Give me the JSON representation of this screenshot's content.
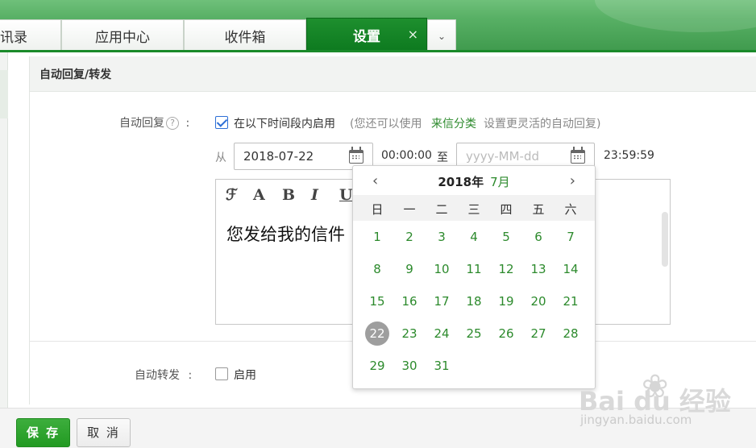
{
  "tabs": {
    "tab1": "讯录",
    "tab2": "应用中心",
    "tab3": "收件箱",
    "active": "设置",
    "close": "×",
    "more": "⌄"
  },
  "panel": {
    "title": "自动回复/转发"
  },
  "auto_reply": {
    "label": "自动回复",
    "help": "?",
    "colon": ":",
    "enable_label": "在以下时间段内启用",
    "hint_prefix": "(您还可以使用",
    "hint_link": "来信分类",
    "hint_suffix": "设置更灵活的自动回复)",
    "from": "从",
    "start_date": "2018-07-22",
    "start_time": "00:00:00",
    "to": "至",
    "end_placeholder": "yyyy-MM-dd",
    "end_time": "23:59:59",
    "enabled": true
  },
  "editor": {
    "tools": [
      "ℱ",
      "A",
      "B",
      "I",
      "U"
    ],
    "body_text": "您发给我的信件"
  },
  "auto_forward": {
    "label": "自动转发",
    "colon": ":",
    "enable_label": "启用",
    "enabled": false
  },
  "buttons": {
    "save": "保 存",
    "cancel": "取 消"
  },
  "calendar": {
    "prev": "‹",
    "next": "›",
    "year": "2018年",
    "month": "7月",
    "weekdays": [
      "日",
      "一",
      "二",
      "三",
      "四",
      "五",
      "六"
    ],
    "selected": 22,
    "weeks": [
      [
        "1",
        "2",
        "3",
        "4",
        "5",
        "6",
        "7"
      ],
      [
        "8",
        "9",
        "10",
        "11",
        "12",
        "13",
        "14"
      ],
      [
        "15",
        "16",
        "17",
        "18",
        "19",
        "20",
        "21"
      ],
      [
        "22",
        "23",
        "24",
        "25",
        "26",
        "27",
        "28"
      ],
      [
        "29",
        "30",
        "31",
        "",
        "",
        "",
        ""
      ]
    ]
  },
  "watermark": {
    "brand": "Bai du 经验",
    "url": "jingyan.baidu.com"
  },
  "colors": {
    "accent_green": "#0d7a1f",
    "link_green": "#2c8a2c",
    "save_green": "#2a9e2a"
  }
}
